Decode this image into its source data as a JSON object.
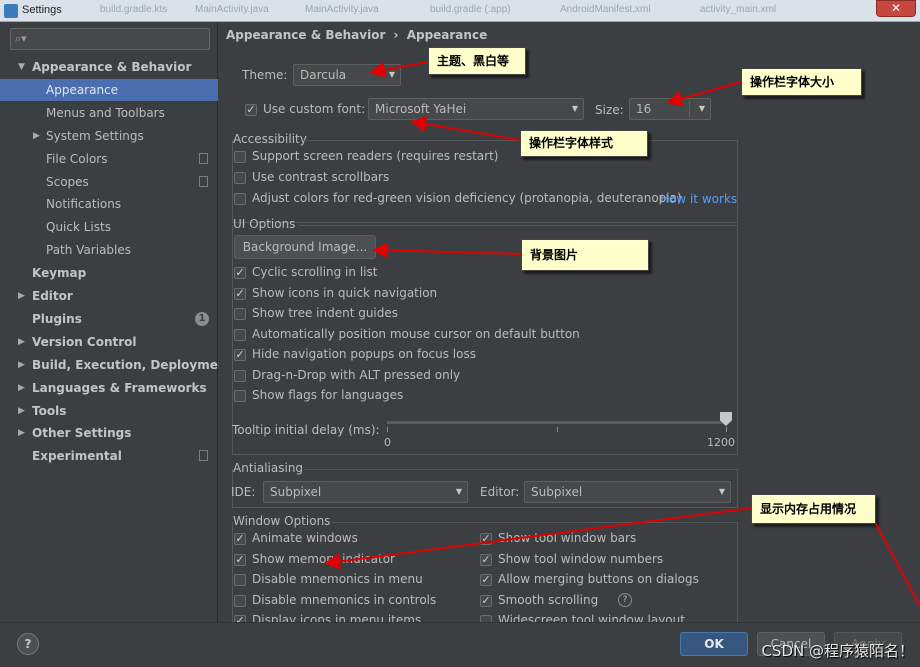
{
  "window": {
    "title": "Settings",
    "close_glyph": "✕",
    "background_tabs": [
      "build.gradle.kts",
      "MainActivity.java",
      "MainActivity.java",
      "build.gradle (:app)",
      "AndroidManifest.xml",
      "activity_main.xml"
    ]
  },
  "sidebar": {
    "search_placeholder": "",
    "search_icon": "search-icon",
    "items": [
      {
        "label": "Appearance & Behavior",
        "level": 0,
        "expanded": true,
        "bold": true
      },
      {
        "label": "Appearance",
        "level": 1,
        "selected": true
      },
      {
        "label": "Menus and Toolbars",
        "level": 1
      },
      {
        "label": "System Settings",
        "level": 1,
        "collapsed": true
      },
      {
        "label": "File Colors",
        "level": 1,
        "icon": "page-icon"
      },
      {
        "label": "Scopes",
        "level": 1,
        "icon": "page-icon"
      },
      {
        "label": "Notifications",
        "level": 1
      },
      {
        "label": "Quick Lists",
        "level": 1
      },
      {
        "label": "Path Variables",
        "level": 1
      },
      {
        "label": "Keymap",
        "level": 0,
        "bold": true
      },
      {
        "label": "Editor",
        "level": 0,
        "collapsed": true,
        "bold": true
      },
      {
        "label": "Plugins",
        "level": 0,
        "bold": true,
        "badge": "1"
      },
      {
        "label": "Version Control",
        "level": 0,
        "collapsed": true,
        "bold": true
      },
      {
        "label": "Build, Execution, Deployment",
        "level": 0,
        "collapsed": true,
        "bold": true
      },
      {
        "label": "Languages & Frameworks",
        "level": 0,
        "collapsed": true,
        "bold": true
      },
      {
        "label": "Tools",
        "level": 0,
        "collapsed": true,
        "bold": true
      },
      {
        "label": "Other Settings",
        "level": 0,
        "collapsed": true,
        "bold": true
      },
      {
        "label": "Experimental",
        "level": 0,
        "bold": true,
        "icon": "page-icon"
      }
    ]
  },
  "breadcrumb": {
    "parent": "Appearance & Behavior",
    "separator": "›",
    "current": "Appearance"
  },
  "theme": {
    "label": "Theme:",
    "value": "Darcula"
  },
  "custom_font": {
    "label": "Use custom font:",
    "checked": true,
    "value": "Microsoft YaHei",
    "size_label": "Size:",
    "size_value": "16"
  },
  "accessibility": {
    "title": "Accessibility",
    "options": [
      {
        "label": "Support screen readers (requires restart)",
        "checked": false
      },
      {
        "label": "Use contrast scrollbars",
        "checked": false
      },
      {
        "label": "Adjust colors for red-green vision deficiency (protanopia, deuteranopia)",
        "checked": false
      }
    ],
    "link": "How it works"
  },
  "ui_options": {
    "title": "UI Options",
    "background_button": "Background Image...",
    "options": [
      {
        "label": "Cyclic scrolling in list",
        "checked": true
      },
      {
        "label": "Show icons in quick navigation",
        "checked": true
      },
      {
        "label": "Show tree indent guides",
        "checked": false
      },
      {
        "label": "Automatically position mouse cursor on default button",
        "checked": false
      },
      {
        "label": "Hide navigation popups on focus loss",
        "checked": true
      },
      {
        "label": "Drag-n-Drop with ALT pressed only",
        "checked": false
      },
      {
        "label": "Show flags for languages",
        "checked": false
      }
    ],
    "tooltip_label": "Tooltip initial delay (ms):",
    "tooltip_min": "0",
    "tooltip_max": "1200",
    "tooltip_value": 1200
  },
  "antialiasing": {
    "title": "Antialiasing",
    "ide_label": "IDE:",
    "ide_value": "Subpixel",
    "editor_label": "Editor:",
    "editor_value": "Subpixel"
  },
  "window_options": {
    "title": "Window Options",
    "left": [
      {
        "label": "Animate windows",
        "checked": true
      },
      {
        "label": "Show memory indicator",
        "checked": true
      },
      {
        "label": "Disable mnemonics in menu",
        "checked": false
      },
      {
        "label": "Disable mnemonics in controls",
        "checked": false
      },
      {
        "label": "Display icons in menu items",
        "checked": true
      }
    ],
    "right": [
      {
        "label": "Show tool window bars",
        "checked": true
      },
      {
        "label": "Show tool window numbers",
        "checked": true
      },
      {
        "label": "Allow merging buttons on dialogs",
        "checked": true
      },
      {
        "label": "Smooth scrolling",
        "checked": true,
        "help": "?"
      },
      {
        "label": "Widescreen tool window layout",
        "checked": false
      }
    ]
  },
  "annotations": {
    "theme": "主题、黑白等",
    "font_size": "操作栏字体大小",
    "font_style": "操作栏字体样式",
    "background": "背景图片",
    "memory": "显示内存占用情况",
    "arrow_color": "#e00000"
  },
  "footer": {
    "help": "?",
    "ok": "OK",
    "cancel": "Cancel",
    "apply": "Apply"
  },
  "watermark": "CSDN @程序猿陌名！"
}
